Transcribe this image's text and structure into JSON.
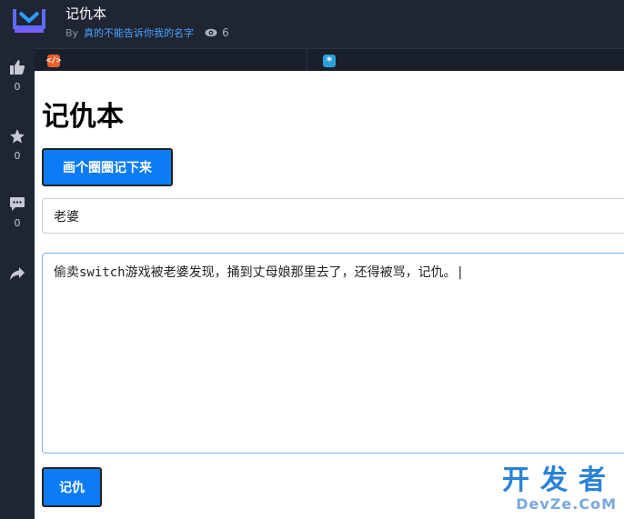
{
  "header": {
    "title": "记仇本",
    "by_label": "By",
    "author": "真的不能告诉你我的名字",
    "views": "6"
  },
  "sidebar": {
    "like_count": "0",
    "star_count": "0",
    "comment_count": "0"
  },
  "tabs": {
    "code_icon": "</>",
    "star_icon": "*"
  },
  "main": {
    "heading": "记仇本",
    "draw_button_label": "画个圈圈记下来",
    "name_value": "老婆",
    "reason_value": "偷卖switch游戏被老婆发现，捅到丈母娘那里去了，还得被骂，记仇。|",
    "record_button_label": "记仇"
  },
  "watermark": {
    "line1": "开发者",
    "line2": "DevZe.CoM"
  },
  "colors": {
    "accent": "#0c7cf5",
    "dark_bg": "#1f2532",
    "author_link": "#4ba3ff"
  }
}
